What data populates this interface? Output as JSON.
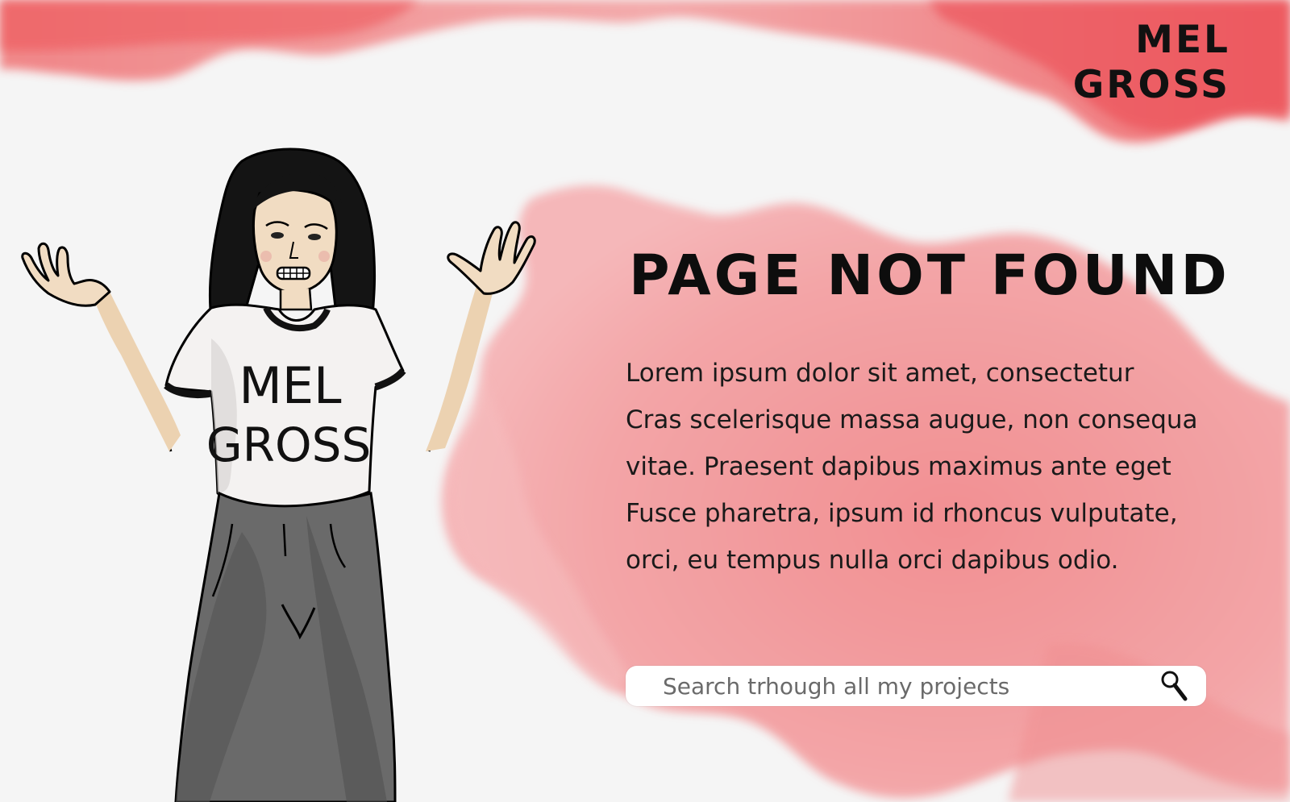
{
  "brand": {
    "logo_line1": "MEL",
    "logo_line2": "GROSS"
  },
  "error": {
    "title": "PAGE NOT FOUND",
    "paragraph_lines": [
      "Lorem ipsum dolor sit amet, consectetur",
      "Cras scelerisque massa augue, non consequa",
      "vitae. Praesent dapibus maximus ante eget",
      "Fusce pharetra, ipsum id rhoncus vulputate,",
      "orci, eu tempus nulla orci dapibus odio."
    ]
  },
  "search": {
    "placeholder": "Search trhough all my projects",
    "icon": "magnifier-icon"
  },
  "illustration": {
    "shirt_line1": "MEL",
    "shirt_line2": "GROSS"
  },
  "colors": {
    "background": "#f5f5f5",
    "watercolor_red": "#ef5b5f",
    "watercolor_pink": "#f29a9c",
    "text": "#111111"
  }
}
